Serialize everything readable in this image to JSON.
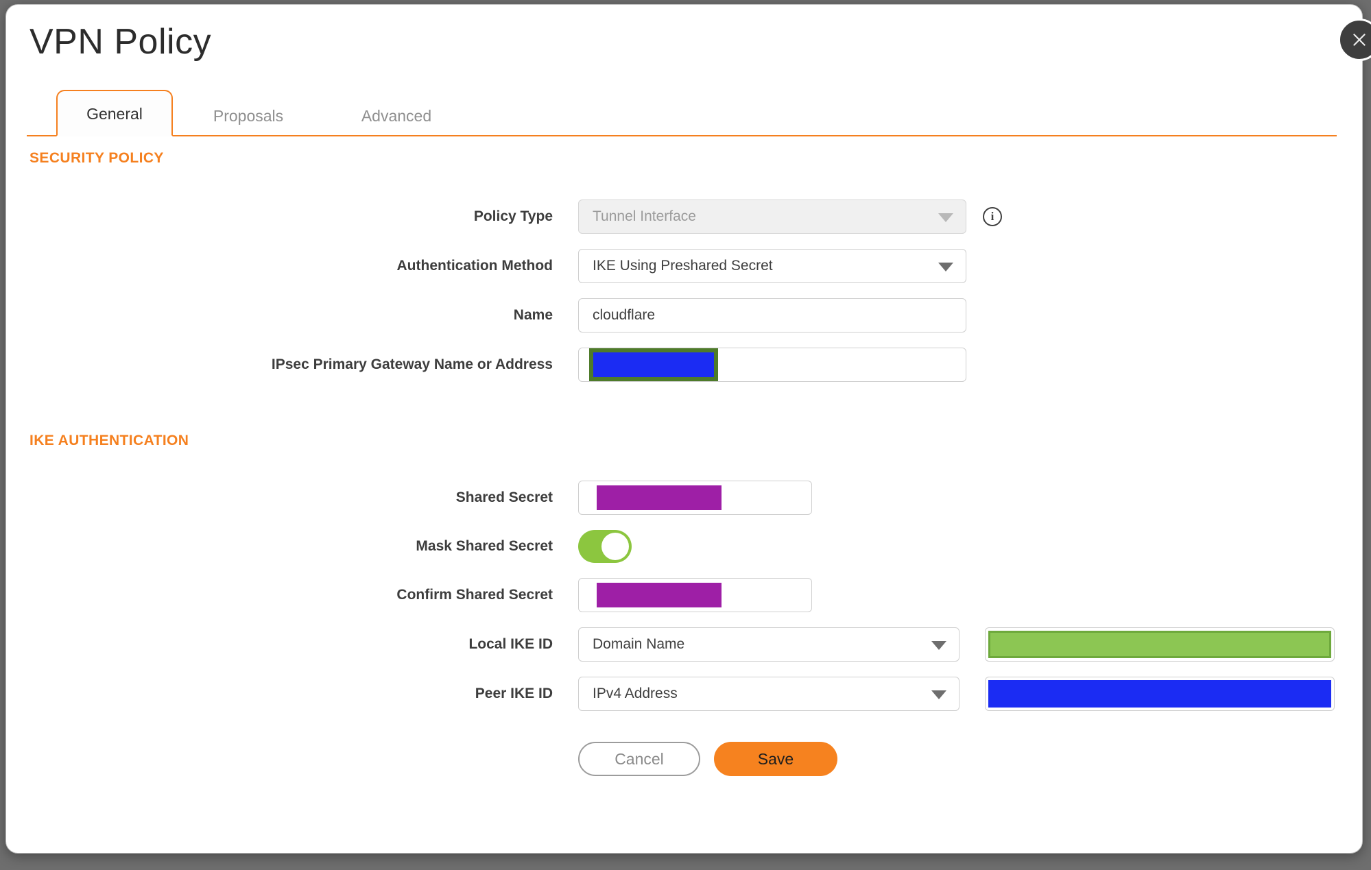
{
  "window": {
    "title": "VPN Policy"
  },
  "tabs": {
    "items": [
      {
        "label": "General",
        "active": true
      },
      {
        "label": "Proposals",
        "active": false
      },
      {
        "label": "Advanced",
        "active": false
      }
    ]
  },
  "sections": {
    "security_policy": {
      "heading": "SECURITY POLICY"
    },
    "ike_authentication": {
      "heading": "IKE AUTHENTICATION"
    }
  },
  "fields": {
    "policy_type": {
      "label": "Policy Type",
      "value": "Tunnel Interface",
      "disabled": true
    },
    "authentication_method": {
      "label": "Authentication Method",
      "value": "IKE Using Preshared Secret"
    },
    "name": {
      "label": "Name",
      "value": "cloudflare"
    },
    "gateway": {
      "label": "IPsec Primary Gateway Name or Address",
      "value": "",
      "redacted": true
    },
    "shared_secret": {
      "label": "Shared Secret",
      "value": "",
      "redacted": true
    },
    "mask_shared_secret": {
      "label": "Mask Shared Secret",
      "state": "on"
    },
    "confirm_shared_secret": {
      "label": "Confirm Shared Secret",
      "value": "",
      "redacted": true
    },
    "local_ike_id": {
      "label": "Local IKE ID",
      "type_value": "Domain Name",
      "value": "",
      "redacted": true
    },
    "peer_ike_id": {
      "label": "Peer IKE ID",
      "type_value": "IPv4 Address",
      "value": "",
      "redacted": true
    }
  },
  "buttons": {
    "cancel": "Cancel",
    "save": "Save"
  },
  "icons": {
    "close": "close-icon",
    "info": "info-icon",
    "dropdown": "chevron-down-icon"
  },
  "colors": {
    "accent_orange": "#f5801f",
    "save_orange": "#f6821f",
    "redaction_blue": "#1b2cf3",
    "redaction_purple": "#9e1fa6",
    "redaction_green": "#8cc653",
    "redaction_olive_border": "#4e7b2a",
    "toggle_green": "#8cc63f",
    "backdrop_gray": "#6e6e6e"
  }
}
